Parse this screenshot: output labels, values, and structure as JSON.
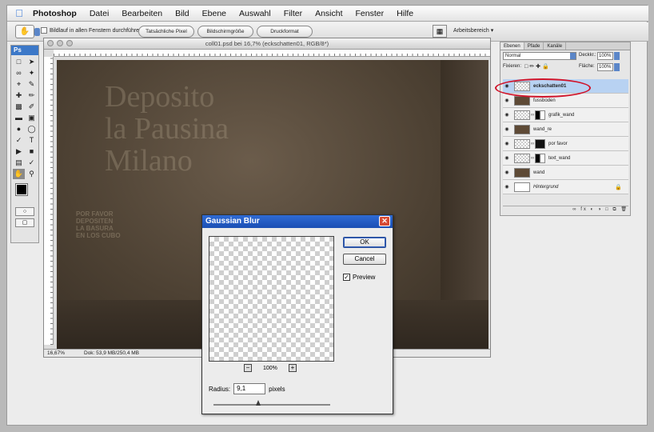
{
  "menubar": {
    "app": "Photoshop",
    "items": [
      "Datei",
      "Bearbeiten",
      "Bild",
      "Ebene",
      "Auswahl",
      "Filter",
      "Ansicht",
      "Fenster",
      "Hilfe"
    ]
  },
  "options": {
    "scroll_all": "Bildlauf in allen Fenstern durchführen",
    "actual_pixels": "Tatsächliche Pixel",
    "fit_screen": "Bildschirmgröße",
    "print_size": "Druckformat",
    "workspace": "Arbeitsbereich"
  },
  "tools": {
    "logo": "Ps"
  },
  "document": {
    "title": "coll01.psd bei 16,7% (eckschatten01, RGB/8*)",
    "zoom": "16,67%",
    "doc_size": "Dok: 53,9 MB/250,4 MB",
    "wall_text_lines": [
      "Deposito",
      "la Pausina",
      "Milano"
    ],
    "wall_small_text": [
      "POR FAVOR",
      "DEPOSITEN",
      "LA BASURA",
      "EN LOS CUBO"
    ]
  },
  "layers_panel": {
    "tabs": [
      "Ebenen",
      "Pfade",
      "Kanäle"
    ],
    "blend_mode": "Normal",
    "opacity_label": "Deckkr.:",
    "opacity_value": "100%",
    "lock_label": "Fixieren:",
    "fill_label": "Fläche:",
    "fill_value": "100%",
    "layers": [
      {
        "name": "eckschatten01",
        "selected": true
      },
      {
        "name": "fussboden"
      },
      {
        "name": "grafik_wand"
      },
      {
        "name": "wand_re"
      },
      {
        "name": "por favor"
      },
      {
        "name": "text_wand"
      },
      {
        "name": "wand"
      },
      {
        "name": "Hintergrund"
      }
    ]
  },
  "dialog": {
    "title": "Gaussian Blur",
    "ok": "OK",
    "cancel": "Cancel",
    "preview_label": "Preview",
    "preview_checked": true,
    "zoom": "100%",
    "radius_label": "Radius:",
    "radius_value": "9,1",
    "radius_unit": "pixels"
  },
  "accent_colors": {
    "highlight_ring": "#d0142a",
    "selection": "#b8d2f2",
    "title_blue": "#2f6bd4"
  }
}
